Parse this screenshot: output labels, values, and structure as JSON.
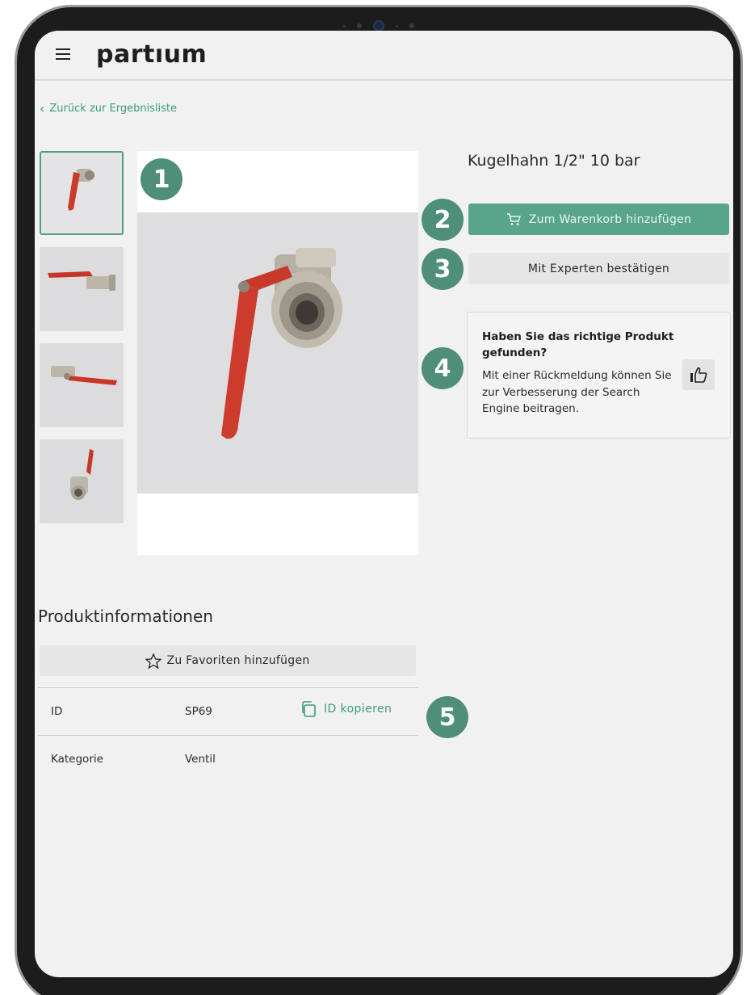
{
  "app": {
    "brand": "partıum"
  },
  "nav": {
    "back_label": "Zurück zur Ergebnisliste"
  },
  "product": {
    "title": "Kugelhahn 1/2\" 10 bar",
    "cart_label": "Zum Warenkorb hinzufügen",
    "expert_label": "Mit Experten bestätigen"
  },
  "feedback": {
    "title": "Haben Sie das richtige Produkt gefunden?",
    "text": "Mit einer Rückmeldung können Sie zur Verbesserung der Search Engine beitragen."
  },
  "info": {
    "section_title": "Produktinformationen",
    "favorite_label": "Zu Favoriten hinzufügen",
    "rows": [
      {
        "key": "ID",
        "value": "SP69",
        "action": "ID kopieren"
      },
      {
        "key": "Kategorie",
        "value": "Ventil"
      }
    ]
  },
  "annotations": [
    "1",
    "2",
    "3",
    "4",
    "5"
  ],
  "colors": {
    "accent": "#58a58c",
    "link": "#3f9a80",
    "badge": "#4f8f79",
    "valve_handle": "#d23b2c"
  },
  "icons": [
    "menu-icon",
    "chevron-left-icon",
    "cart-icon",
    "thumbs-up-icon",
    "star-icon",
    "copy-icon"
  ]
}
